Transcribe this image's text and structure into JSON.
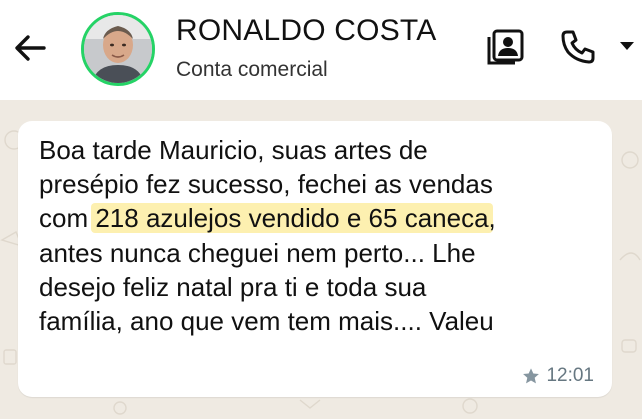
{
  "header": {
    "contact_name": "RONALDO COSTA",
    "contact_subtitle": "Conta comercial",
    "icons": {
      "back": "arrow-left-icon",
      "avatar": "contact-avatar",
      "contact_card": "contact-card-icon",
      "call": "phone-icon",
      "call_menu": "dropdown-caret-icon"
    },
    "accent_color": "#25d366"
  },
  "message": {
    "lines": [
      "Boa tarde Mauricio, suas artes de",
      "presépio fez sucesso, fechei as vendas",
      "antes nunca cheguei nem perto... Lhe",
      "desejo feliz natal pra ti e toda sua",
      "família, ano que vem tem mais.... Valeu"
    ],
    "line3_prefix": "com ",
    "line3_highlight": "218 azulejos vendido e 65 caneca",
    "line3_suffix": ",",
    "time": "12:01",
    "starred": true,
    "highlight_color": "#fdf0b0"
  }
}
